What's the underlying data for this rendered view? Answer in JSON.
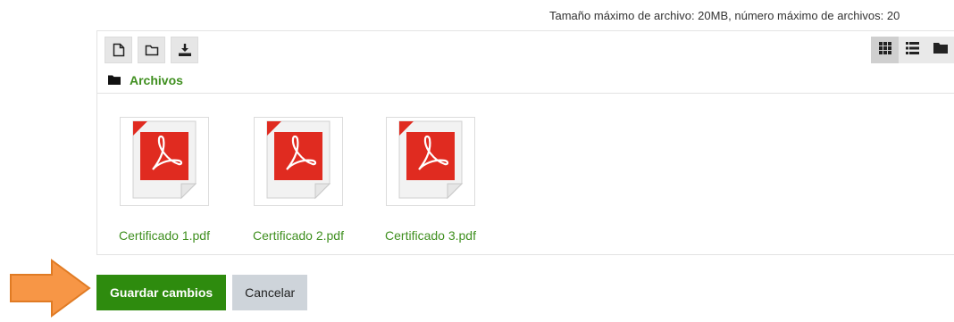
{
  "limits_text": "Tamaño máximo de archivo: 20MB, número máximo de archivos: 20",
  "toolbar": {
    "icons": [
      "add-file-icon",
      "create-folder-icon",
      "download-icon"
    ]
  },
  "views": {
    "icons": [
      "grid-view-icon",
      "list-view-icon",
      "tree-view-icon"
    ],
    "active": "grid-view-icon"
  },
  "path": {
    "folder_label": "Archivos"
  },
  "files": [
    {
      "name": "Certificado 1.pdf",
      "icon": "pdf-icon"
    },
    {
      "name": "Certificado 2.pdf",
      "icon": "pdf-icon"
    },
    {
      "name": "Certificado 3.pdf",
      "icon": "pdf-icon"
    }
  ],
  "actions": {
    "save_label": "Guardar cambios",
    "cancel_label": "Cancelar"
  },
  "colors": {
    "link_green": "#3f8f1f",
    "primary_green": "#2e8b0e",
    "arrow_orange": "#f79646",
    "pdf_red": "#e02b20"
  }
}
